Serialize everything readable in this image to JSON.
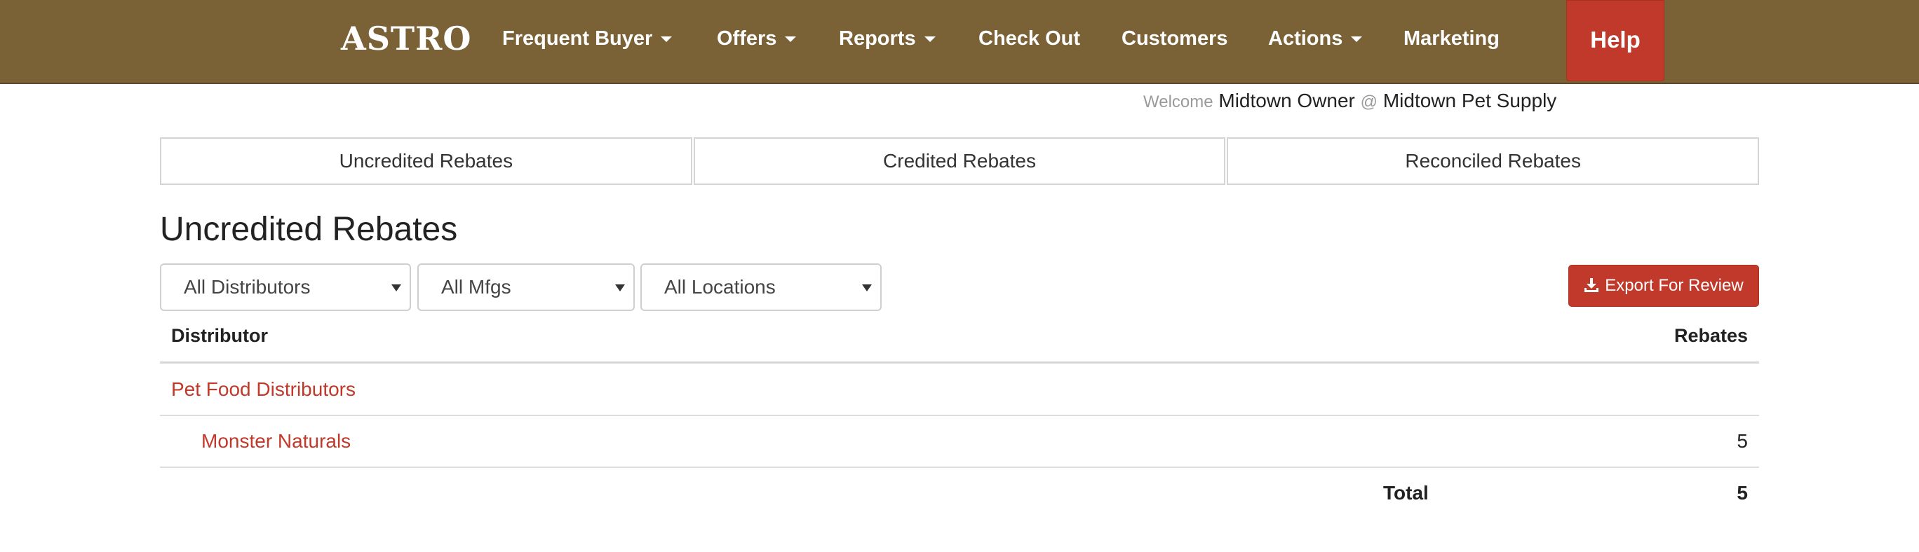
{
  "navbar": {
    "logo": "ASTRO",
    "items": [
      {
        "label": "Frequent Buyer",
        "dropdown": true
      },
      {
        "label": "Offers",
        "dropdown": true
      },
      {
        "label": "Reports",
        "dropdown": true
      },
      {
        "label": "Check Out",
        "dropdown": false
      },
      {
        "label": "Customers",
        "dropdown": false
      },
      {
        "label": "Actions",
        "dropdown": true
      },
      {
        "label": "Marketing",
        "dropdown": false
      }
    ],
    "help": "Help",
    "bg_color": "#7a6236",
    "accent_color": "#c0392b"
  },
  "welcome": {
    "prefix": "Welcome",
    "user": "Midtown Owner",
    "at": "@",
    "store": "Midtown Pet Supply"
  },
  "tabs": [
    {
      "label": "Uncredited Rebates"
    },
    {
      "label": "Credited Rebates"
    },
    {
      "label": "Reconciled Rebates"
    }
  ],
  "page_title": "Uncredited Rebates",
  "filters": {
    "distributor": "All Distributors",
    "mfg": "All Mfgs",
    "location": "All Locations"
  },
  "export_label": "Export For Review",
  "table": {
    "headers": {
      "distributor": "Distributor",
      "rebates": "Rebates"
    },
    "group": "Pet Food Distributors",
    "rows": [
      {
        "name": "Monster Naturals",
        "rebates": "5"
      }
    ],
    "total_label": "Total",
    "total_value": "5"
  }
}
